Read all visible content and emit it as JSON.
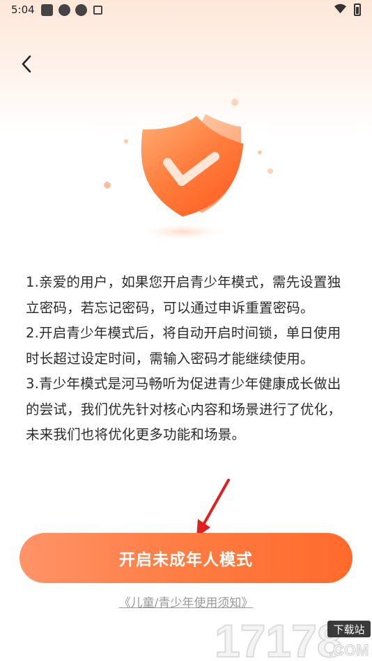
{
  "status_bar": {
    "time": "5:04"
  },
  "header": {
    "back_icon": "chevron-left-icon"
  },
  "illustration": {
    "icon": "shield-check-icon",
    "accent_color": "#ff7a3f"
  },
  "notice": {
    "paragraphs": [
      "1.亲爱的用户，如果您开启青少年模式，需先设置独立密码，若忘记密码，可以通过申诉重置密码。",
      "2.开启青少年模式后，将自动开启时间锁，单日使用时长超过设定时间，需输入密码才能继续使用。",
      "3.青少年模式是河马畅听为促进青少年健康成长做出的尝试，我们优先针对核心内容和场景进行了优化，未来我们也将优化更多功能和场景。"
    ]
  },
  "actions": {
    "primary_label": "开启未成年人模式",
    "guide_link": "《儿童/青少年使用须知》"
  },
  "watermark": {
    "number": "17178",
    "badge": "下载站",
    "suffix": ".COM"
  },
  "colors": {
    "button_start": "#ff9368",
    "button_end": "#ff6a2c",
    "text": "#2b2b2b",
    "link": "#9a9a9a",
    "annotation_arrow": "#e0201f"
  }
}
